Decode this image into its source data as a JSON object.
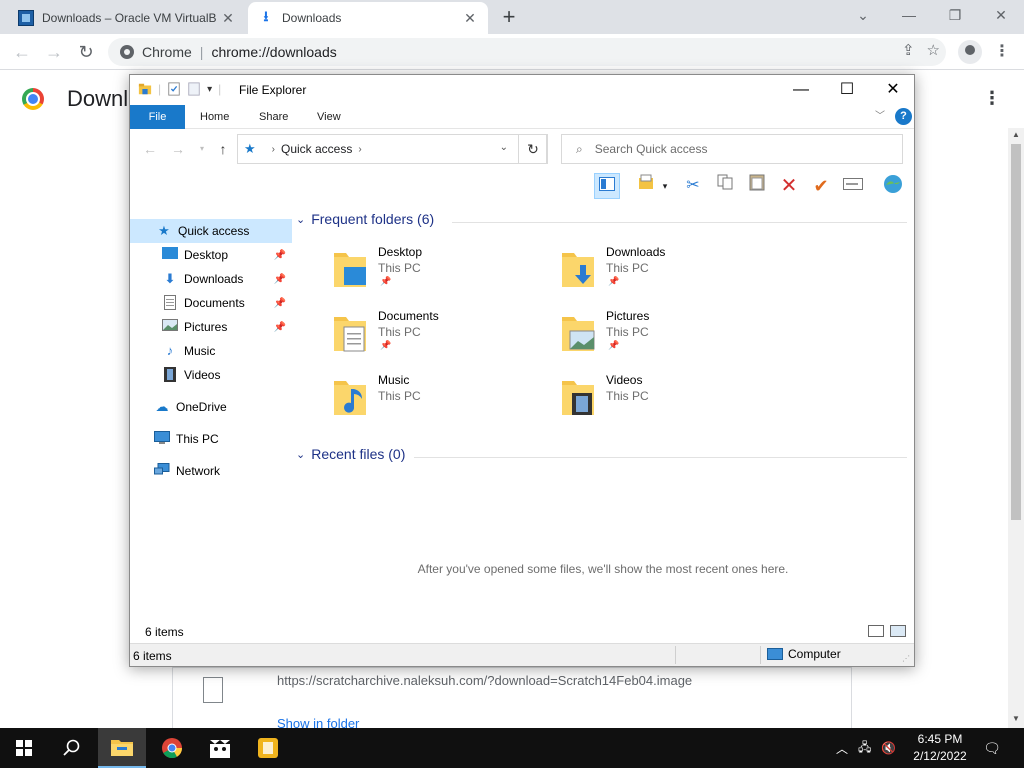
{
  "browser": {
    "tabs": [
      {
        "title": "Downloads – Oracle VM VirtualB",
        "active": false
      },
      {
        "title": "Downloads",
        "active": true
      }
    ],
    "omnibox": {
      "scheme_label": "Chrome",
      "separator": "|",
      "url": "chrome://downloads"
    }
  },
  "downloads_page": {
    "heading": "Downl",
    "item": {
      "url": "https://scratcharchive.naleksuh.com/?download=Scratch14Feb04.image",
      "show_in_folder": "Show in folder"
    }
  },
  "explorer": {
    "title": "File Explorer",
    "ribbon_tabs": [
      "File",
      "Home",
      "Share",
      "View"
    ],
    "help": "?",
    "address": {
      "crumb": "Quick access"
    },
    "search_placeholder": "Search Quick access",
    "nav": [
      {
        "label": "Quick access",
        "icon": "star-icon",
        "selected": true,
        "pinned": false
      },
      {
        "label": "Desktop",
        "icon": "desktop-icon",
        "selected": false,
        "pinned": true
      },
      {
        "label": "Downloads",
        "icon": "download-arrow-icon",
        "selected": false,
        "pinned": true
      },
      {
        "label": "Documents",
        "icon": "document-icon",
        "selected": false,
        "pinned": true
      },
      {
        "label": "Pictures",
        "icon": "pictures-icon",
        "selected": false,
        "pinned": true
      },
      {
        "label": "Music",
        "icon": "music-note-icon",
        "selected": false,
        "pinned": false
      },
      {
        "label": "Videos",
        "icon": "film-icon",
        "selected": false,
        "pinned": false
      },
      {
        "label": "OneDrive",
        "icon": "cloud-icon",
        "selected": false,
        "pinned": false
      },
      {
        "label": "This PC",
        "icon": "monitor-icon",
        "selected": false,
        "pinned": false
      },
      {
        "label": "Network",
        "icon": "network-icon",
        "selected": false,
        "pinned": false
      }
    ],
    "frequent_header": "Frequent folders (6)",
    "frequent": [
      {
        "name": "Desktop",
        "location": "This PC",
        "pinned": true,
        "overlay": "desktop-icon"
      },
      {
        "name": "Downloads",
        "location": "This PC",
        "pinned": true,
        "overlay": "download-arrow-icon"
      },
      {
        "name": "Documents",
        "location": "This PC",
        "pinned": true,
        "overlay": "document-icon"
      },
      {
        "name": "Pictures",
        "location": "This PC",
        "pinned": true,
        "overlay": "pictures-icon"
      },
      {
        "name": "Music",
        "location": "This PC",
        "pinned": false,
        "overlay": "music-note-icon"
      },
      {
        "name": "Videos",
        "location": "This PC",
        "pinned": false,
        "overlay": "film-icon"
      }
    ],
    "recent_header": "Recent files (0)",
    "recent_empty_message": "After you've opened some files, we'll show the most recent ones here.",
    "items_count_inner": "6 items",
    "items_count_status": "6 items",
    "status_location": "Computer"
  },
  "taskbar": {
    "clock_time": "6:45 PM",
    "clock_date": "2/12/2022"
  },
  "colors": {
    "accent": "#1979ca",
    "selection": "#cce8ff",
    "group_header": "#1e3287",
    "taskbar": "#101010"
  }
}
